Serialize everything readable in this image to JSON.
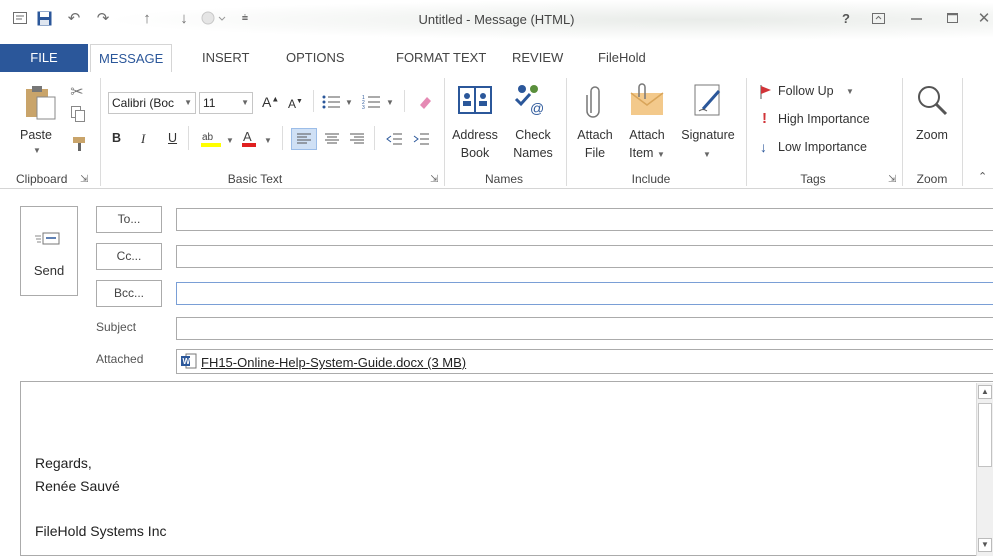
{
  "window": {
    "title": "Untitled - Message (HTML)",
    "help": "?",
    "icons": [
      "outlook-message-icon",
      "save-icon",
      "undo-icon",
      "redo-icon",
      "up-arrow-icon",
      "down-arrow-icon",
      "record-icon",
      "customize-qat-icon",
      "help-icon",
      "ribbon-display-icon",
      "minimize-icon",
      "maximize-icon",
      "close-icon"
    ]
  },
  "tabs": [
    "FILE",
    "MESSAGE",
    "INSERT",
    "OPTIONS",
    "FORMAT TEXT",
    "REVIEW",
    "FileHold"
  ],
  "ribbon": {
    "clipboard": {
      "paste": "Paste",
      "label": "Clipboard"
    },
    "basic_text": {
      "font": "Calibri (Boc",
      "size": "11",
      "bold": "B",
      "italic": "I",
      "underline": "U",
      "label": "Basic Text"
    },
    "names": {
      "address_book_1": "Address",
      "address_book_2": "Book",
      "check_names_1": "Check",
      "check_names_2": "Names",
      "label": "Names"
    },
    "include": {
      "attach_file_1": "Attach",
      "attach_file_2": "File",
      "attach_item_1": "Attach",
      "attach_item_2": "Item",
      "signature": "Signature",
      "label": "Include"
    },
    "tags": {
      "follow_up": "Follow Up",
      "high_importance": "High Importance",
      "low_importance": "Low Importance",
      "label": "Tags"
    },
    "zoom": {
      "zoom": "Zoom",
      "label": "Zoom"
    }
  },
  "compose": {
    "send": "Send",
    "to": "To...",
    "cc": "Cc...",
    "bcc": "Bcc...",
    "subject_label": "Subject",
    "attached_label": "Attached",
    "attachment": "FH15-Online-Help-System-Guide.docx (3 MB)"
  },
  "body": {
    "line1": "Regards,",
    "line2": "Renée Sauvé",
    "line3": "FileHold Systems Inc"
  },
  "colors": {
    "file_tab": "#2b579a",
    "highlight": "#ffff00",
    "font_color": "#e02020",
    "flag": "#d13438",
    "low_arrow": "#2b579a"
  }
}
